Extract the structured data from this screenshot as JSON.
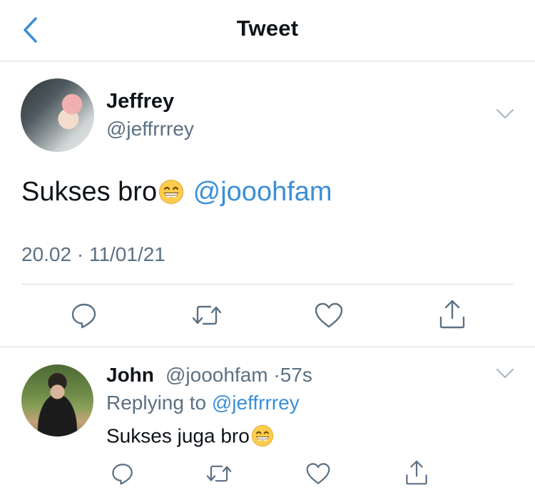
{
  "header": {
    "title": "Tweet",
    "back_icon": "chevron-left-icon"
  },
  "tweet": {
    "author_name": "Jeffrey",
    "author_handle": "@jeffrrrey",
    "text": "Sukses bro",
    "emoji": "grinning-face-with-smiling-eyes",
    "mention": "@jooohfam",
    "timestamp": "20.02 · 11/01/21",
    "actions": [
      "reply-icon",
      "retweet-icon",
      "like-icon",
      "share-icon"
    ]
  },
  "reply": {
    "author_name": "John",
    "author_handle": "@jooohfam",
    "separator": "·",
    "age": "57s",
    "replying_to_label": "Replying to",
    "replying_to_handle": "@jeffrrrey",
    "text": "Sukses juga bro",
    "emoji": "grinning-face-with-smiling-eyes"
  },
  "colors": {
    "accent": "#3a8fd8",
    "secondary_text": "#5b7083",
    "icon_gray": "#5b7083",
    "divider": "#d9d9de"
  }
}
